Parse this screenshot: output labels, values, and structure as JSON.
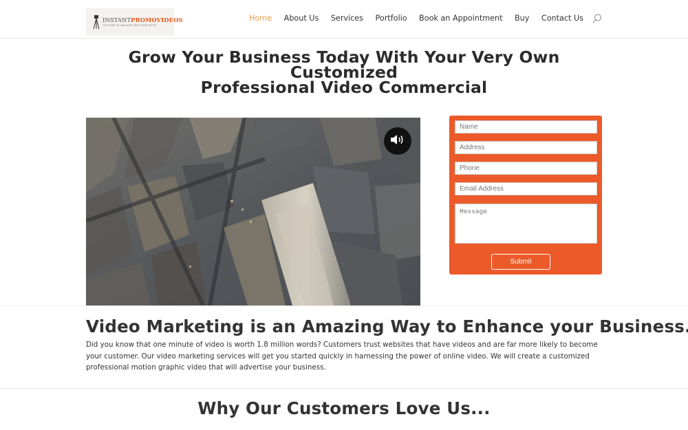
{
  "header": {
    "logo": {
      "name_part1": "INSTANT",
      "name_part2": "PROMOVIDEOS",
      "tagline": "THE HOME OF AWESOME VIDEO RESOURCES"
    },
    "nav": [
      {
        "label": "Home",
        "active": true
      },
      {
        "label": "About Us",
        "active": false
      },
      {
        "label": "Services",
        "active": false
      },
      {
        "label": "Portfolio",
        "active": false
      },
      {
        "label": "Book an Appointment",
        "active": false
      },
      {
        "label": "Buy",
        "active": false
      },
      {
        "label": "Contact Us",
        "active": false
      }
    ],
    "search_icon": "search-icon"
  },
  "hero": {
    "title_line1": "Grow Your Business Today With Your Very Own Customized",
    "title_line2": "Professional Video Commercial",
    "video": {
      "volume_icon": "volume-icon"
    }
  },
  "form": {
    "name_placeholder": "Name",
    "address_placeholder": "Address",
    "phone_placeholder": "Phone",
    "email_placeholder": "Email Address",
    "message_placeholder": "Message",
    "submit_label": "Submit"
  },
  "section": {
    "title": "Video Marketing is an Amazing Way to Enhance your Business...",
    "body": "Did you know that one minute of video is worth 1.8 million words? Customers trust websites that have videos and are far more likely to become your customer. Our video marketing services will get you started quickly in harnessing the power of online video. We will create a customized professional motion graphic video that will advertise your business."
  },
  "customers": {
    "title": "Why Our Customers Love Us..."
  },
  "colors": {
    "accent": "#ec5a2a",
    "nav_active": "#e89a4a",
    "text": "#333333"
  }
}
